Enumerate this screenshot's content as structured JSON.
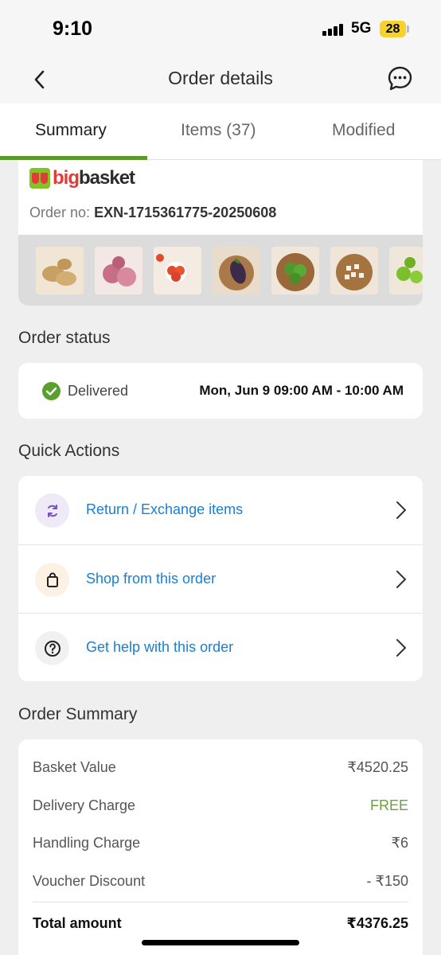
{
  "status_bar": {
    "time": "9:10",
    "network": "5G",
    "battery": "28"
  },
  "header": {
    "title": "Order details"
  },
  "tabs": [
    {
      "label": "Summary",
      "active": true
    },
    {
      "label": "Items (37)",
      "active": false
    },
    {
      "label": "Modified",
      "active": false
    }
  ],
  "order": {
    "brand_big": "big",
    "brand_basket": "basket",
    "order_no_label": "Order no:",
    "order_no": "EXN-1715361775-20250608",
    "thumbnails": [
      "potato",
      "onion",
      "tomato",
      "brinjal",
      "capsicum",
      "garlic",
      "lime"
    ]
  },
  "order_status": {
    "section_title": "Order status",
    "status": "Delivered",
    "slot": "Mon, Jun 9 09:00 AM - 10:00 AM"
  },
  "quick_actions": {
    "section_title": "Quick Actions",
    "items": [
      {
        "label": "Return / Exchange items",
        "icon": "refresh-icon"
      },
      {
        "label": "Shop from this order",
        "icon": "shopping-bag-icon"
      },
      {
        "label": "Get help with this order",
        "icon": "help-icon"
      }
    ]
  },
  "order_summary": {
    "section_title": "Order Summary",
    "rows": [
      {
        "label": "Basket Value",
        "value": "₹4520.25"
      },
      {
        "label": "Delivery Charge",
        "value": "FREE"
      },
      {
        "label": "Handling Charge",
        "value": "₹6"
      },
      {
        "label": "Voucher Discount",
        "value": "- ₹150"
      }
    ],
    "total_label": "Total amount",
    "total_value": "₹4376.25"
  },
  "colors": {
    "accent_green": "#5a9a2b",
    "link_blue": "#1a7fd0",
    "brand_red": "#e23b38"
  }
}
